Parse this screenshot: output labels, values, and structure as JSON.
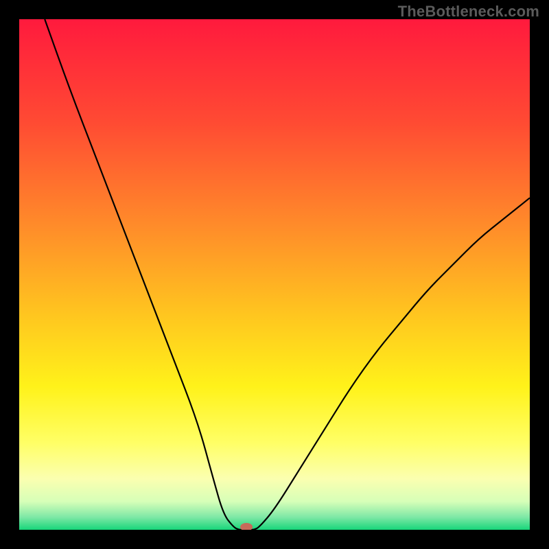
{
  "watermark": "TheBottleneck.com",
  "chart_data": {
    "type": "line",
    "title": "",
    "xlabel": "",
    "ylabel": "",
    "xlim": [
      0,
      100
    ],
    "ylim": [
      0,
      100
    ],
    "grid": false,
    "legend": false,
    "background_gradient": {
      "stops": [
        {
          "offset": 0.0,
          "color": "#ff1a3d"
        },
        {
          "offset": 0.2,
          "color": "#ff4a33"
        },
        {
          "offset": 0.4,
          "color": "#ff8a2a"
        },
        {
          "offset": 0.58,
          "color": "#ffc61f"
        },
        {
          "offset": 0.72,
          "color": "#fff21a"
        },
        {
          "offset": 0.83,
          "color": "#ffff66"
        },
        {
          "offset": 0.9,
          "color": "#fbffb0"
        },
        {
          "offset": 0.945,
          "color": "#d6ffb8"
        },
        {
          "offset": 0.975,
          "color": "#7fe8a6"
        },
        {
          "offset": 1.0,
          "color": "#17d67a"
        }
      ]
    },
    "series": [
      {
        "name": "bottleneck-curve",
        "stroke": "#000000",
        "x": [
          5,
          10,
          15,
          20,
          25,
          30,
          35,
          38,
          40,
          42,
          43,
          44,
          45,
          46,
          47,
          50,
          55,
          60,
          65,
          70,
          75,
          80,
          85,
          90,
          95,
          100
        ],
        "y": [
          100,
          86,
          73,
          60,
          47,
          34,
          21,
          10,
          3,
          0.5,
          0,
          0,
          0,
          0,
          0.5,
          4,
          12,
          20,
          28,
          35,
          41,
          47,
          52,
          57,
          61,
          65
        ]
      }
    ],
    "marker": {
      "name": "optimal-point",
      "x": 44.5,
      "y": 0,
      "color": "#c66a5a",
      "shape": "ellipse"
    }
  }
}
